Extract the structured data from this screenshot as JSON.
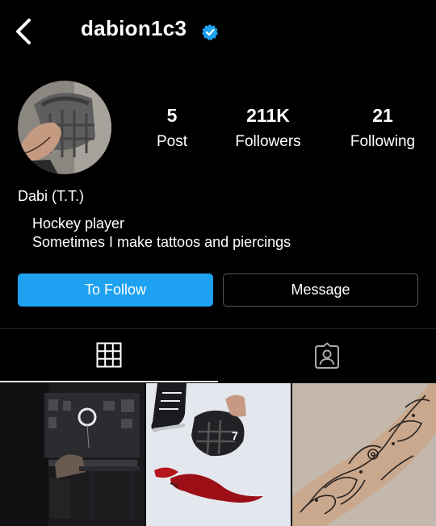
{
  "header": {
    "username": "dabion1c3"
  },
  "stats": [
    {
      "value": "5",
      "label": "Post"
    },
    {
      "value": "211K",
      "label": "Followers"
    },
    {
      "value": "21",
      "label": "Following"
    }
  ],
  "profile": {
    "name": "Dabi (T.T.)",
    "bio_line1": "Hockey player",
    "bio_line2": "Sometimes I make tattoos and piercings"
  },
  "buttons": {
    "follow": "To Follow",
    "message": "Message"
  },
  "colors": {
    "accent": "#1ea1f1",
    "background": "#000000"
  },
  "icons": {
    "back": "chevron-left-icon",
    "verified": "verified-badge-icon",
    "grid": "grid-icon",
    "tagged": "tagged-person-icon"
  }
}
